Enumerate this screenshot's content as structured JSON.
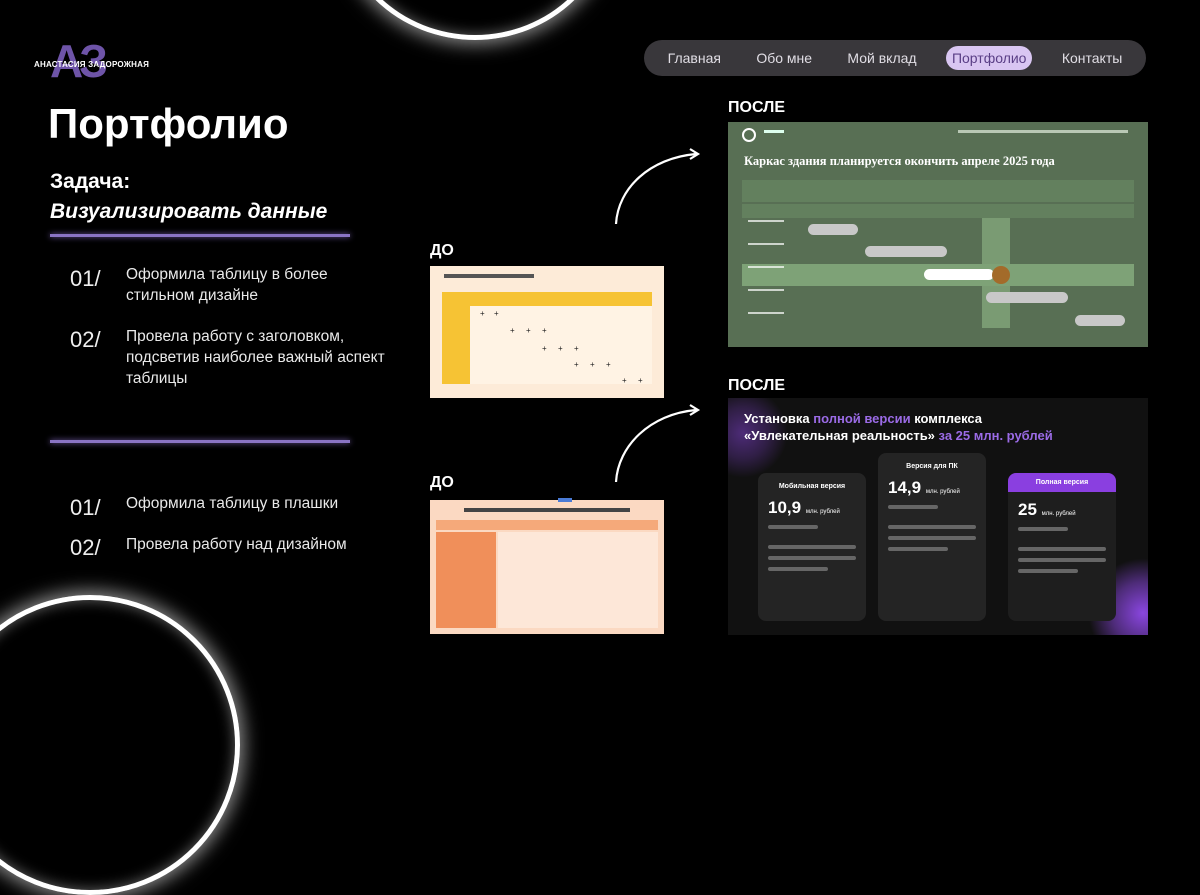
{
  "logo": {
    "mark": "АЗ",
    "name": "АНАСТАСИЯ ЗАДОРОЖНАЯ"
  },
  "nav": {
    "items": [
      "Главная",
      "Обо мне",
      "Мой вклад",
      "Портфолио",
      "Контакты"
    ],
    "active": "Портфолио"
  },
  "page": {
    "title": "Портфолио",
    "task_label": "Задача:",
    "task_value": "Визуализировать данные"
  },
  "list1": [
    {
      "num": "01/",
      "text": "Оформила таблицу в более стильном дизайне"
    },
    {
      "num": "02/",
      "text": "Провела работу с заголовком, подсветив наиболее важный аспект таблицы"
    }
  ],
  "list2": [
    {
      "num": "01/",
      "text": "Оформила таблицу в плашки"
    },
    {
      "num": "02/",
      "text": "Провела работу над дизайном"
    }
  ],
  "labels": {
    "before": "ДО",
    "after": "ПОСЛЕ"
  },
  "after1": {
    "title": "Каркас здания планируется окончить апреле 2025 года"
  },
  "after2": {
    "title_a": "Установка ",
    "title_b": "полной версии",
    "title_c": " комплекса",
    "title_d": "«Увлекательная реальность» ",
    "title_e": "за 25 млн. рублей",
    "cards": [
      {
        "header": "Мобильная версия",
        "price": "10,9",
        "unit": "млн. рублей"
      },
      {
        "header": "Версия для ПК",
        "price": "14,9",
        "unit": "млн. рублей"
      },
      {
        "header": "Полная версия",
        "price": "25",
        "unit": "млн. рублей"
      }
    ]
  },
  "colors": {
    "accent": "#8a74c4",
    "nav_bg": "#39373b",
    "active_pill": "#d9c6f2",
    "gantt_bg": "#586f54",
    "purple": "#9b6be6"
  }
}
